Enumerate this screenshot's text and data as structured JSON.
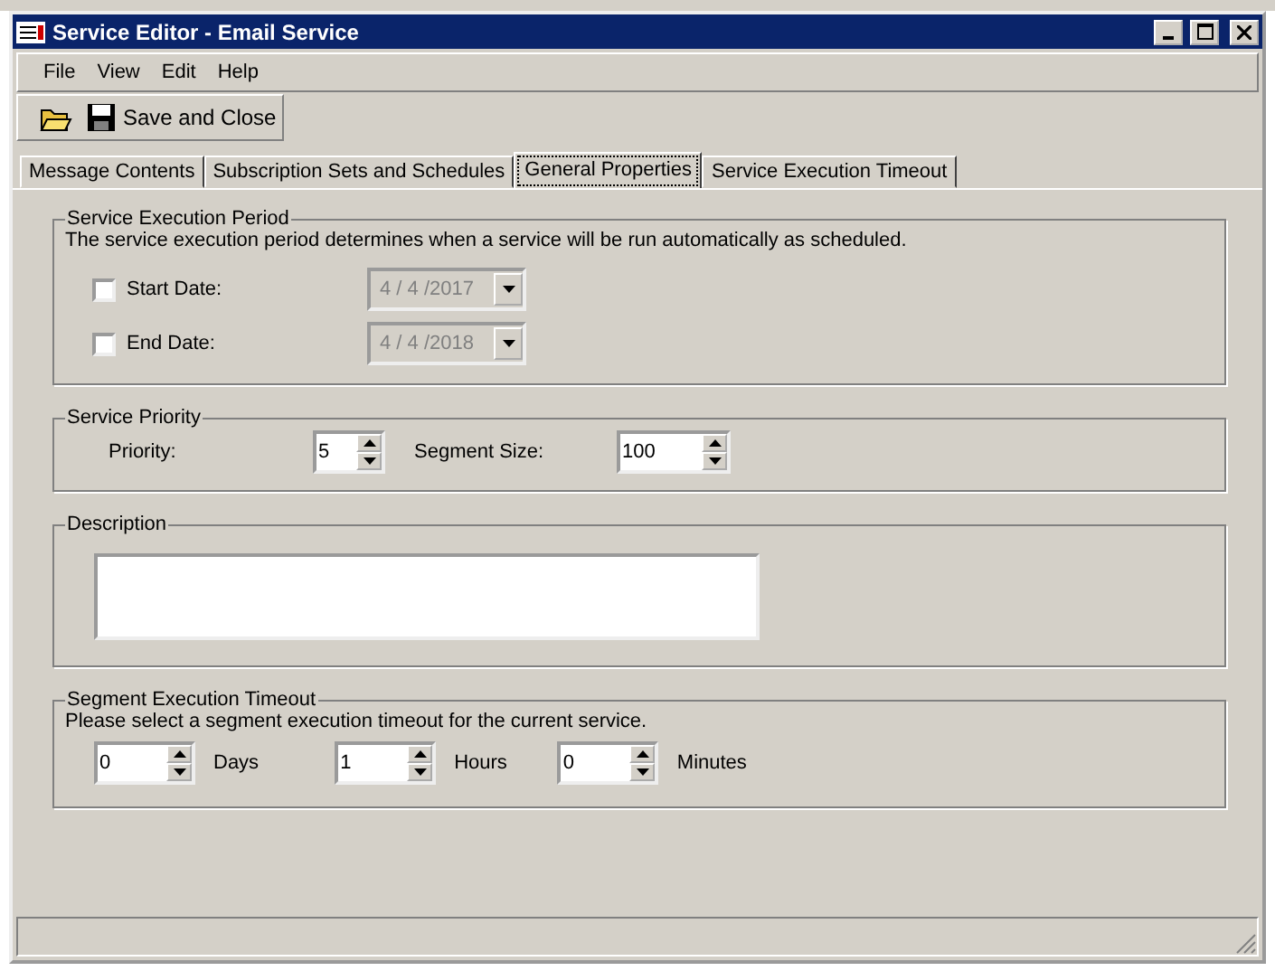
{
  "window": {
    "title": "Service Editor - Email Service"
  },
  "menu": [
    "File",
    "View",
    "Edit",
    "Help"
  ],
  "toolbar": [
    {
      "kind": "open"
    },
    {
      "kind": "save",
      "label": "Save and Close"
    }
  ],
  "tabs": [
    {
      "label": "Message Contents",
      "selected": false
    },
    {
      "label": "Subscription Sets and Schedules",
      "selected": false
    },
    {
      "label": "General Properties",
      "selected": true
    },
    {
      "label": "Service Execution Timeout",
      "selected": false
    }
  ],
  "execution_period": {
    "title": "Service Execution Period",
    "text": "The service execution period determines when a service will be run automatically as scheduled.",
    "dates": [
      {
        "label": "Start Date:",
        "checked": false,
        "value": "4 / 4 /2017",
        "disabled": true
      },
      {
        "label": "End Date:",
        "checked": false,
        "value": "4 / 4 /2018",
        "disabled": true
      }
    ]
  },
  "priority": {
    "title": "Service Priority",
    "fields": [
      {
        "label": "Priority:",
        "value": "5"
      },
      {
        "label": "Segment Size:",
        "value": "100"
      }
    ]
  },
  "description": {
    "title": "Description"
  },
  "timeout": {
    "title": "Segment Execution Timeout",
    "text": "Please select a segment execution timeout for the current service.",
    "fields": [
      {
        "value": "0",
        "unit": "Days"
      },
      {
        "value": "1",
        "unit": "Hours"
      },
      {
        "value": "0",
        "unit": "Minutes"
      }
    ]
  }
}
